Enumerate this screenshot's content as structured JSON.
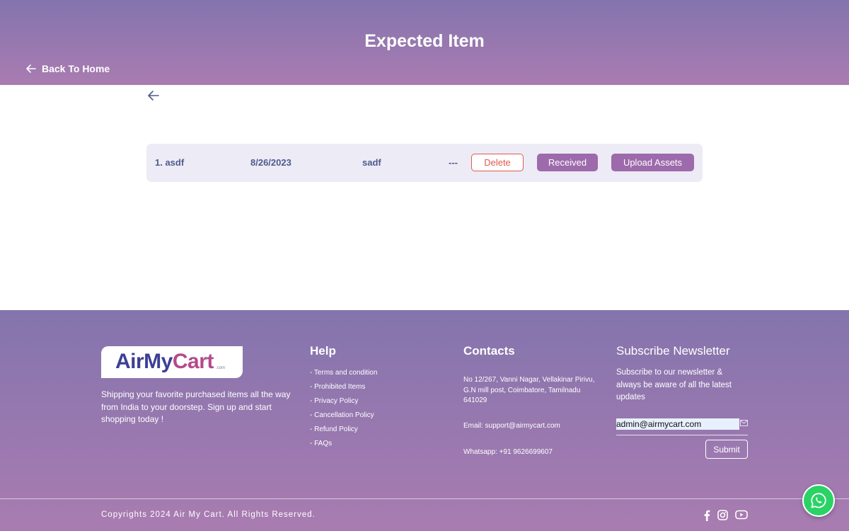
{
  "header": {
    "title": "Expected Item",
    "back_home_label": "Back To Home"
  },
  "item": {
    "name": "1. asdf",
    "date": "8/26/2023",
    "description": "sadf",
    "placeholder": "---",
    "delete_label": "Delete",
    "received_label": "Received",
    "upload_label": "Upload Assets"
  },
  "footer": {
    "logo": "AirMyCart",
    "logo_part1": "AirMy",
    "logo_part2": "Cart",
    "logo_sub": ".com",
    "about": "Shipping your favorite purchased items all the way from India to your doorstep. Sign up and start shopping today !",
    "help": {
      "title": "Help",
      "items": [
        "- Terms and condition",
        "- Prohibited Items",
        "- Privacy Policy",
        "- Cancellation Policy",
        "- Refund Policy",
        "- FAQs"
      ]
    },
    "contacts": {
      "title": "Contacts",
      "address": "No 12/267, Vanni Nagar, Vellakinar Pirivu, G.N mill post, Coimbatore, Tamilnadu 641029",
      "email": "Email: support@airmycart.com",
      "whatsapp": "Whatsapp: +91 9626699607"
    },
    "newsletter": {
      "title": "Subscribe Newsletter",
      "description": "Subscribe to our newsletter & always be aware of all the latest updates",
      "email_value": "admin@airmycart.com",
      "submit_label": "Submit"
    },
    "copyright": "Copyrights 2024 Air My Cart. All Rights Reserved.",
    "social_icons": [
      "facebook-icon",
      "instagram-icon",
      "youtube-icon"
    ]
  },
  "colors": {
    "header_gradient_top": "#8474ad",
    "header_gradient_bottom": "#a97cb1",
    "button_purple": "#9d6aab",
    "delete_red": "#e05a4e",
    "row_background": "#edebf5",
    "row_text": "#4e5a8d",
    "whatsapp_green": "#29d366"
  }
}
